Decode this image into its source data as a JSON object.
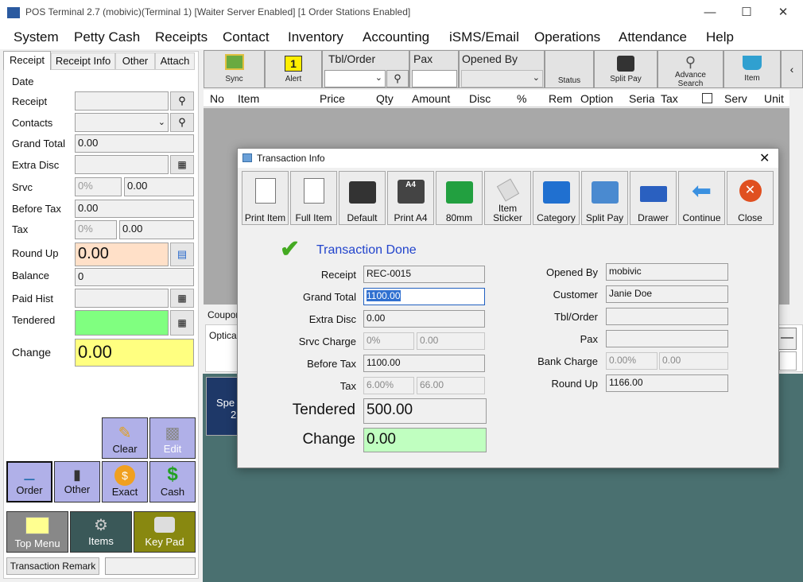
{
  "window": {
    "title": "POS Terminal 2.7 (mobivic)(Terminal 1) [Waiter Server Enabled] [1 Order Stations Enabled]"
  },
  "menu": [
    "System",
    "Petty Cash",
    "Receipts",
    "Contact",
    "Inventory",
    "Accounting",
    "iSMS/Email",
    "Operations",
    "Attendance",
    "Help"
  ],
  "left": {
    "tabs": [
      "Receipt",
      "Receipt Info",
      "Other",
      "Attach"
    ],
    "labels": {
      "date": "Date",
      "receipt": "Receipt",
      "contacts": "Contacts",
      "grand_total": "Grand Total",
      "extra_disc": "Extra Disc",
      "srvc": "Srvc",
      "before_tax": "Before Tax",
      "tax": "Tax",
      "round_up": "Round Up",
      "balance": "Balance",
      "paid_hist": "Paid Hist",
      "tendered": "Tendered",
      "change": "Change"
    },
    "values": {
      "grand_total": "0.00",
      "srvc_pct": "0%",
      "srvc_amt": "0.00",
      "before_tax": "0.00",
      "tax_pct": "0%",
      "tax_amt": "0.00",
      "round_up": "0.00",
      "balance": "0",
      "change": "0.00"
    },
    "buttons": {
      "clear": "Clear",
      "edit": "Edit",
      "order": "Order",
      "other": "Other",
      "exact": "Exact",
      "cash": "Cash",
      "top_menu": "Top Menu",
      "items": "Items",
      "key_pad": "Key Pad",
      "transaction_remark": "Transaction Remark"
    }
  },
  "toolbar": {
    "sync": "Sync",
    "alert": "Alert",
    "alert_count": "1",
    "tbl_order": "Tbl/Order",
    "pax": "Pax",
    "opened_by": "Opened By",
    "status": "Status",
    "split_pay": "Split Pay",
    "advance_search": "Advance Search",
    "item": "Item",
    "more": "‹"
  },
  "grid_columns": [
    "No",
    "Item",
    "Price",
    "Qty",
    "Amount",
    "Disc",
    "%",
    "Rem",
    "Option",
    "Serial",
    "Tax",
    "",
    "Serv",
    "Unit"
  ],
  "behind": {
    "coupon": "Coupon",
    "optical": "Optical",
    "spe": "Spe",
    "two": "2"
  },
  "dialog": {
    "title": "Transaction Info",
    "buttons": [
      "Print Item",
      "Full Item",
      "Default",
      "Print A4",
      "80mm",
      "Item Sticker",
      "Category",
      "Split Pay",
      "Drawer",
      "Continue",
      "Close"
    ],
    "status": "Transaction Done",
    "left_labels": {
      "receipt": "Receipt",
      "grand_total": "Grand Total",
      "extra_disc": "Extra Disc",
      "srvc_charge": "Srvc Charge",
      "before_tax": "Before Tax",
      "tax": "Tax",
      "tendered": "Tendered",
      "change": "Change"
    },
    "left_values": {
      "receipt": "REC-0015",
      "grand_total": "1100.00",
      "extra_disc": "0.00",
      "srvc_pct": "0%",
      "srvc_amt": "0.00",
      "before_tax": "1100.00",
      "tax_pct": "6.00%",
      "tax_amt": "66.00",
      "tendered": "500.00",
      "change": "0.00"
    },
    "right_labels": {
      "opened_by": "Opened By",
      "customer": "Customer",
      "tbl_order": "Tbl/Order",
      "pax": "Pax",
      "bank_charge": "Bank Charge",
      "round_up": "Round Up"
    },
    "right_values": {
      "opened_by": "mobivic",
      "customer": "Janie Doe",
      "tbl_order": "",
      "pax": "",
      "bank_pct": "0.00%",
      "bank_amt": "0.00",
      "round_up": "1166.00"
    }
  },
  "colors": {
    "accent_blue": "#2244cc",
    "tendered_green": "#80ff80",
    "change_yellow": "#ffff80",
    "round_up_peach": "#ffe0c8",
    "dialog_change_green": "#c0ffc0"
  }
}
